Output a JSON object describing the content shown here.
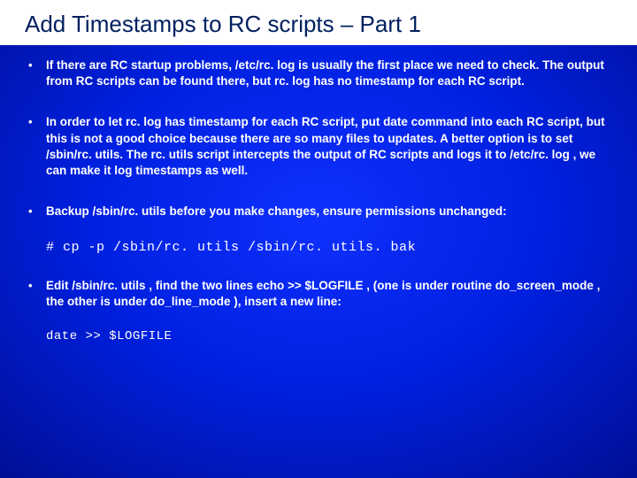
{
  "title": "Add Timestamps to RC scripts – Part 1",
  "bullets": {
    "b1": "If there are RC startup problems, /etc/rc. log is usually the first place we need to check. The output from RC scripts can be found there, but rc. log has no timestamp for each RC script.",
    "b2": "In order to let rc. log has timestamp for each RC script, put date command into each RC script, but this is not a good choice because there are so many files to updates. A better option is to set /sbin/rc. utils. The rc. utils script intercepts the output of RC scripts and logs it to /etc/rc. log , we can make it log timestamps as well.",
    "b3": "Backup /sbin/rc. utils before you make changes, ensure permissions unchanged:",
    "b4": "Edit /sbin/rc. utils , find the two lines echo >> $LOGFILE , (one is under routine do_screen_mode , the other is under do_line_mode ), insert a new line:"
  },
  "code": {
    "c1": "# cp -p /sbin/rc. utils /sbin/rc. utils. bak",
    "c2": "date >> $LOGFILE"
  }
}
